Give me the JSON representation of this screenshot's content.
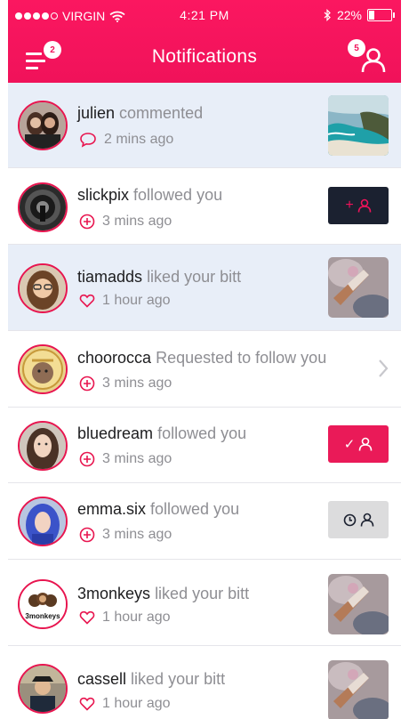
{
  "status_bar": {
    "carrier": "VIRGIN",
    "time": "4:21 PM",
    "battery": "22%",
    "battery_level": 0.22
  },
  "header": {
    "title": "Notifications",
    "menu_badge": "2",
    "user_badge": "5"
  },
  "colors": {
    "accent": "#f0125a",
    "highlight_row": "#e8eef8",
    "follow_button_dark": "#1b2130",
    "following_button": "#ea1a58",
    "pending_button": "#dcdcdd"
  },
  "notifications": [
    {
      "user": "julien",
      "action": "commented",
      "time": "2 mins ago",
      "icon": "comment-icon",
      "trailing": "thumbnail-beach",
      "highlighted": true
    },
    {
      "user": "slickpix",
      "action": "followed you",
      "time": "3 mins ago",
      "icon": "plus-circle-icon",
      "trailing": "follow-back-button",
      "highlighted": false
    },
    {
      "user": "tiamadds",
      "action": "liked your bitt",
      "time": "1 hour ago",
      "icon": "heart-icon",
      "trailing": "thumbnail-cup",
      "highlighted": true
    },
    {
      "user": "choorocca",
      "action": "Requested to follow you",
      "time": "3 mins ago",
      "icon": "plus-circle-icon",
      "trailing": "chevron-right-icon",
      "highlighted": false
    },
    {
      "user": "bluedream",
      "action": "followed you",
      "time": "3 mins ago",
      "icon": "plus-circle-icon",
      "trailing": "following-button",
      "highlighted": false
    },
    {
      "user": "emma.six",
      "action": "followed you",
      "time": "3 mins ago",
      "icon": "plus-circle-icon",
      "trailing": "pending-button",
      "highlighted": false
    },
    {
      "user": "3monkeys",
      "action": "liked your bitt",
      "time": "1 hour ago",
      "icon": "heart-icon",
      "trailing": "thumbnail-cup",
      "highlighted": false
    },
    {
      "user": "cassell",
      "action": "liked your bitt",
      "time": "1 hour ago",
      "icon": "heart-icon",
      "trailing": "thumbnail-cup",
      "highlighted": false
    }
  ],
  "follow_button_glyph": "+",
  "following_button_glyph": "✓",
  "avatar_3monkeys_text": "3monkeys"
}
